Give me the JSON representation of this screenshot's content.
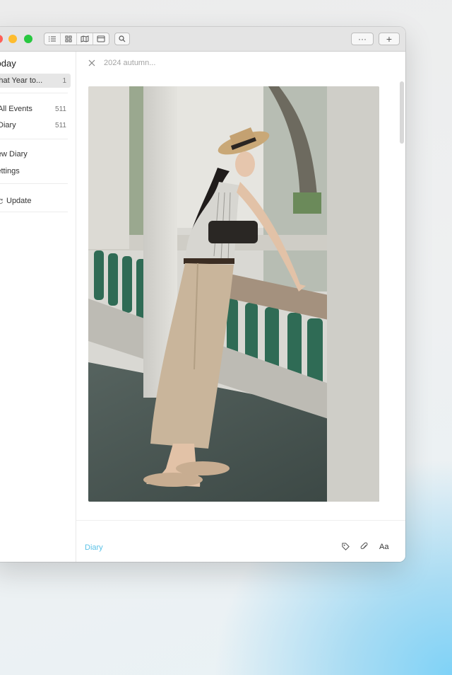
{
  "sidebar": {
    "today_label": "Today",
    "items": [
      {
        "label": "What Year to...",
        "count": "1"
      },
      {
        "label": "All Events",
        "count": "511",
        "color": "#333333"
      },
      {
        "label": "Diary",
        "count": "511",
        "color": "#5bc2e7"
      }
    ],
    "new_diary": "New Diary",
    "settings": "Settings",
    "update": "Update"
  },
  "entry": {
    "title_placeholder": "2024 autumn...",
    "notebook_label": "Diary"
  },
  "toolbar": {
    "more_label": "···",
    "add_label": "+",
    "view_icons": [
      "list-icon",
      "grid-icon",
      "map-icon",
      "calendar-icon"
    ]
  },
  "footer": {
    "font_label": "Aa"
  },
  "colors": {
    "accent": "#5bc2e7",
    "traffic_red": "#fe5f57",
    "traffic_yellow": "#febc2e",
    "traffic_green": "#28c840"
  }
}
